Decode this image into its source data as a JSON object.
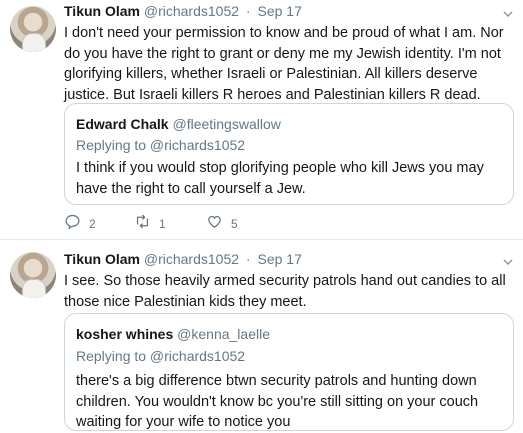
{
  "tweets": [
    {
      "author": {
        "name": "Tikun Olam",
        "handle": "@richards1052",
        "date": "Sep 17"
      },
      "text": "I don't need your permission to know and be proud of what I am. Nor do you have the right to grant or deny me my Jewish identity.  I'm not glorifying killers, whether Israeli or Palestinian. All killers deserve justice. But Israeli killers R heroes and Palestinian killers R dead.",
      "quoted": {
        "name": "Edward Chalk",
        "handle": "@fleetingswallow",
        "replying_to": "Replying to @richards1052",
        "text": "I think if you would stop glorifying people who kill Jews you may have the right to call yourself a Jew."
      },
      "actions": {
        "replies": "2",
        "retweets": "1",
        "likes": "5"
      }
    },
    {
      "author": {
        "name": "Tikun Olam",
        "handle": "@richards1052",
        "date": "Sep 17"
      },
      "text": "I see. So those heavily armed security patrols hand out candies to all those nice Palestinian kids they meet.",
      "quoted": {
        "name": "kosher whines",
        "handle": "@kenna_laelle",
        "replying_to": "Replying to @richards1052",
        "text": "there's a big difference btwn security patrols and hunting down children. You wouldn't know bc you're still sitting on your couch waiting for your wife to notice you"
      }
    }
  ],
  "icons": {
    "reply": "reply-icon",
    "retweet": "retweet-icon",
    "like": "heart-icon",
    "menu": "chevron-down-icon"
  },
  "colors": {
    "secondary_text": "#657786",
    "border": "#ccd6dd",
    "icon": "#657786"
  }
}
